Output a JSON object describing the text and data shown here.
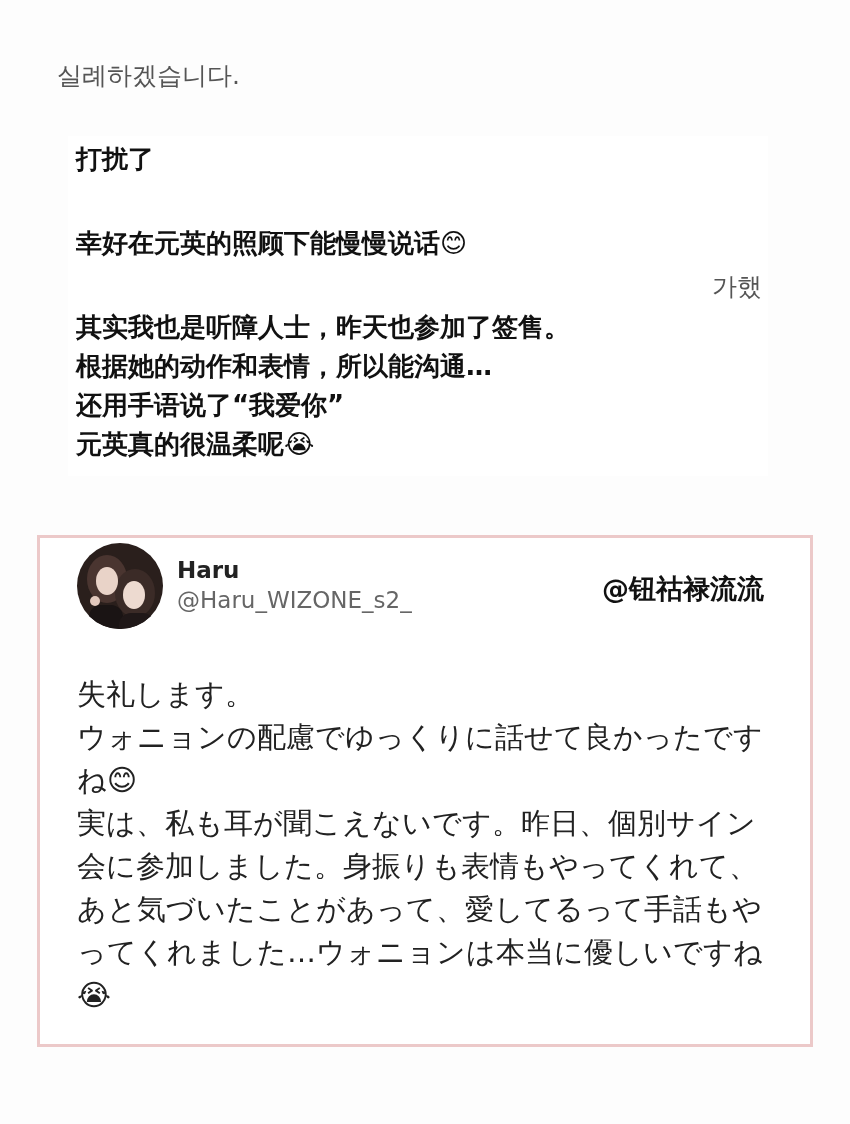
{
  "original_post": {
    "greeting": "실례하겠습니다.",
    "covered_fragment": "가했"
  },
  "translation_overlay": {
    "paragraphs": [
      [
        "打扰了"
      ],
      [
        "幸好在元英的照顾下能慢慢说话😊"
      ],
      [
        "其实我也是听障人士，昨天也参加了签售。",
        "根据她的动作和表情，所以能沟通…",
        "还用手语说了“我爱你”",
        "元英真的很温柔呢😭"
      ]
    ]
  },
  "quoted_tweet": {
    "display_name": "Haru",
    "handle": "@Haru_WIZONE_s2_",
    "credit": "@钮祜禄流流",
    "body": [
      "失礼します。",
      "ウォニョンの配慮でゆっくりに話せて良かったですね😊",
      "実は、私も耳が聞こえないです。昨日、個別サイン会に参加しました。身振りも表情もやってくれて、あと気づいたことがあって、愛してるって手話もやってくれました…ウォニョンは本当に優しいですね😭"
    ]
  }
}
